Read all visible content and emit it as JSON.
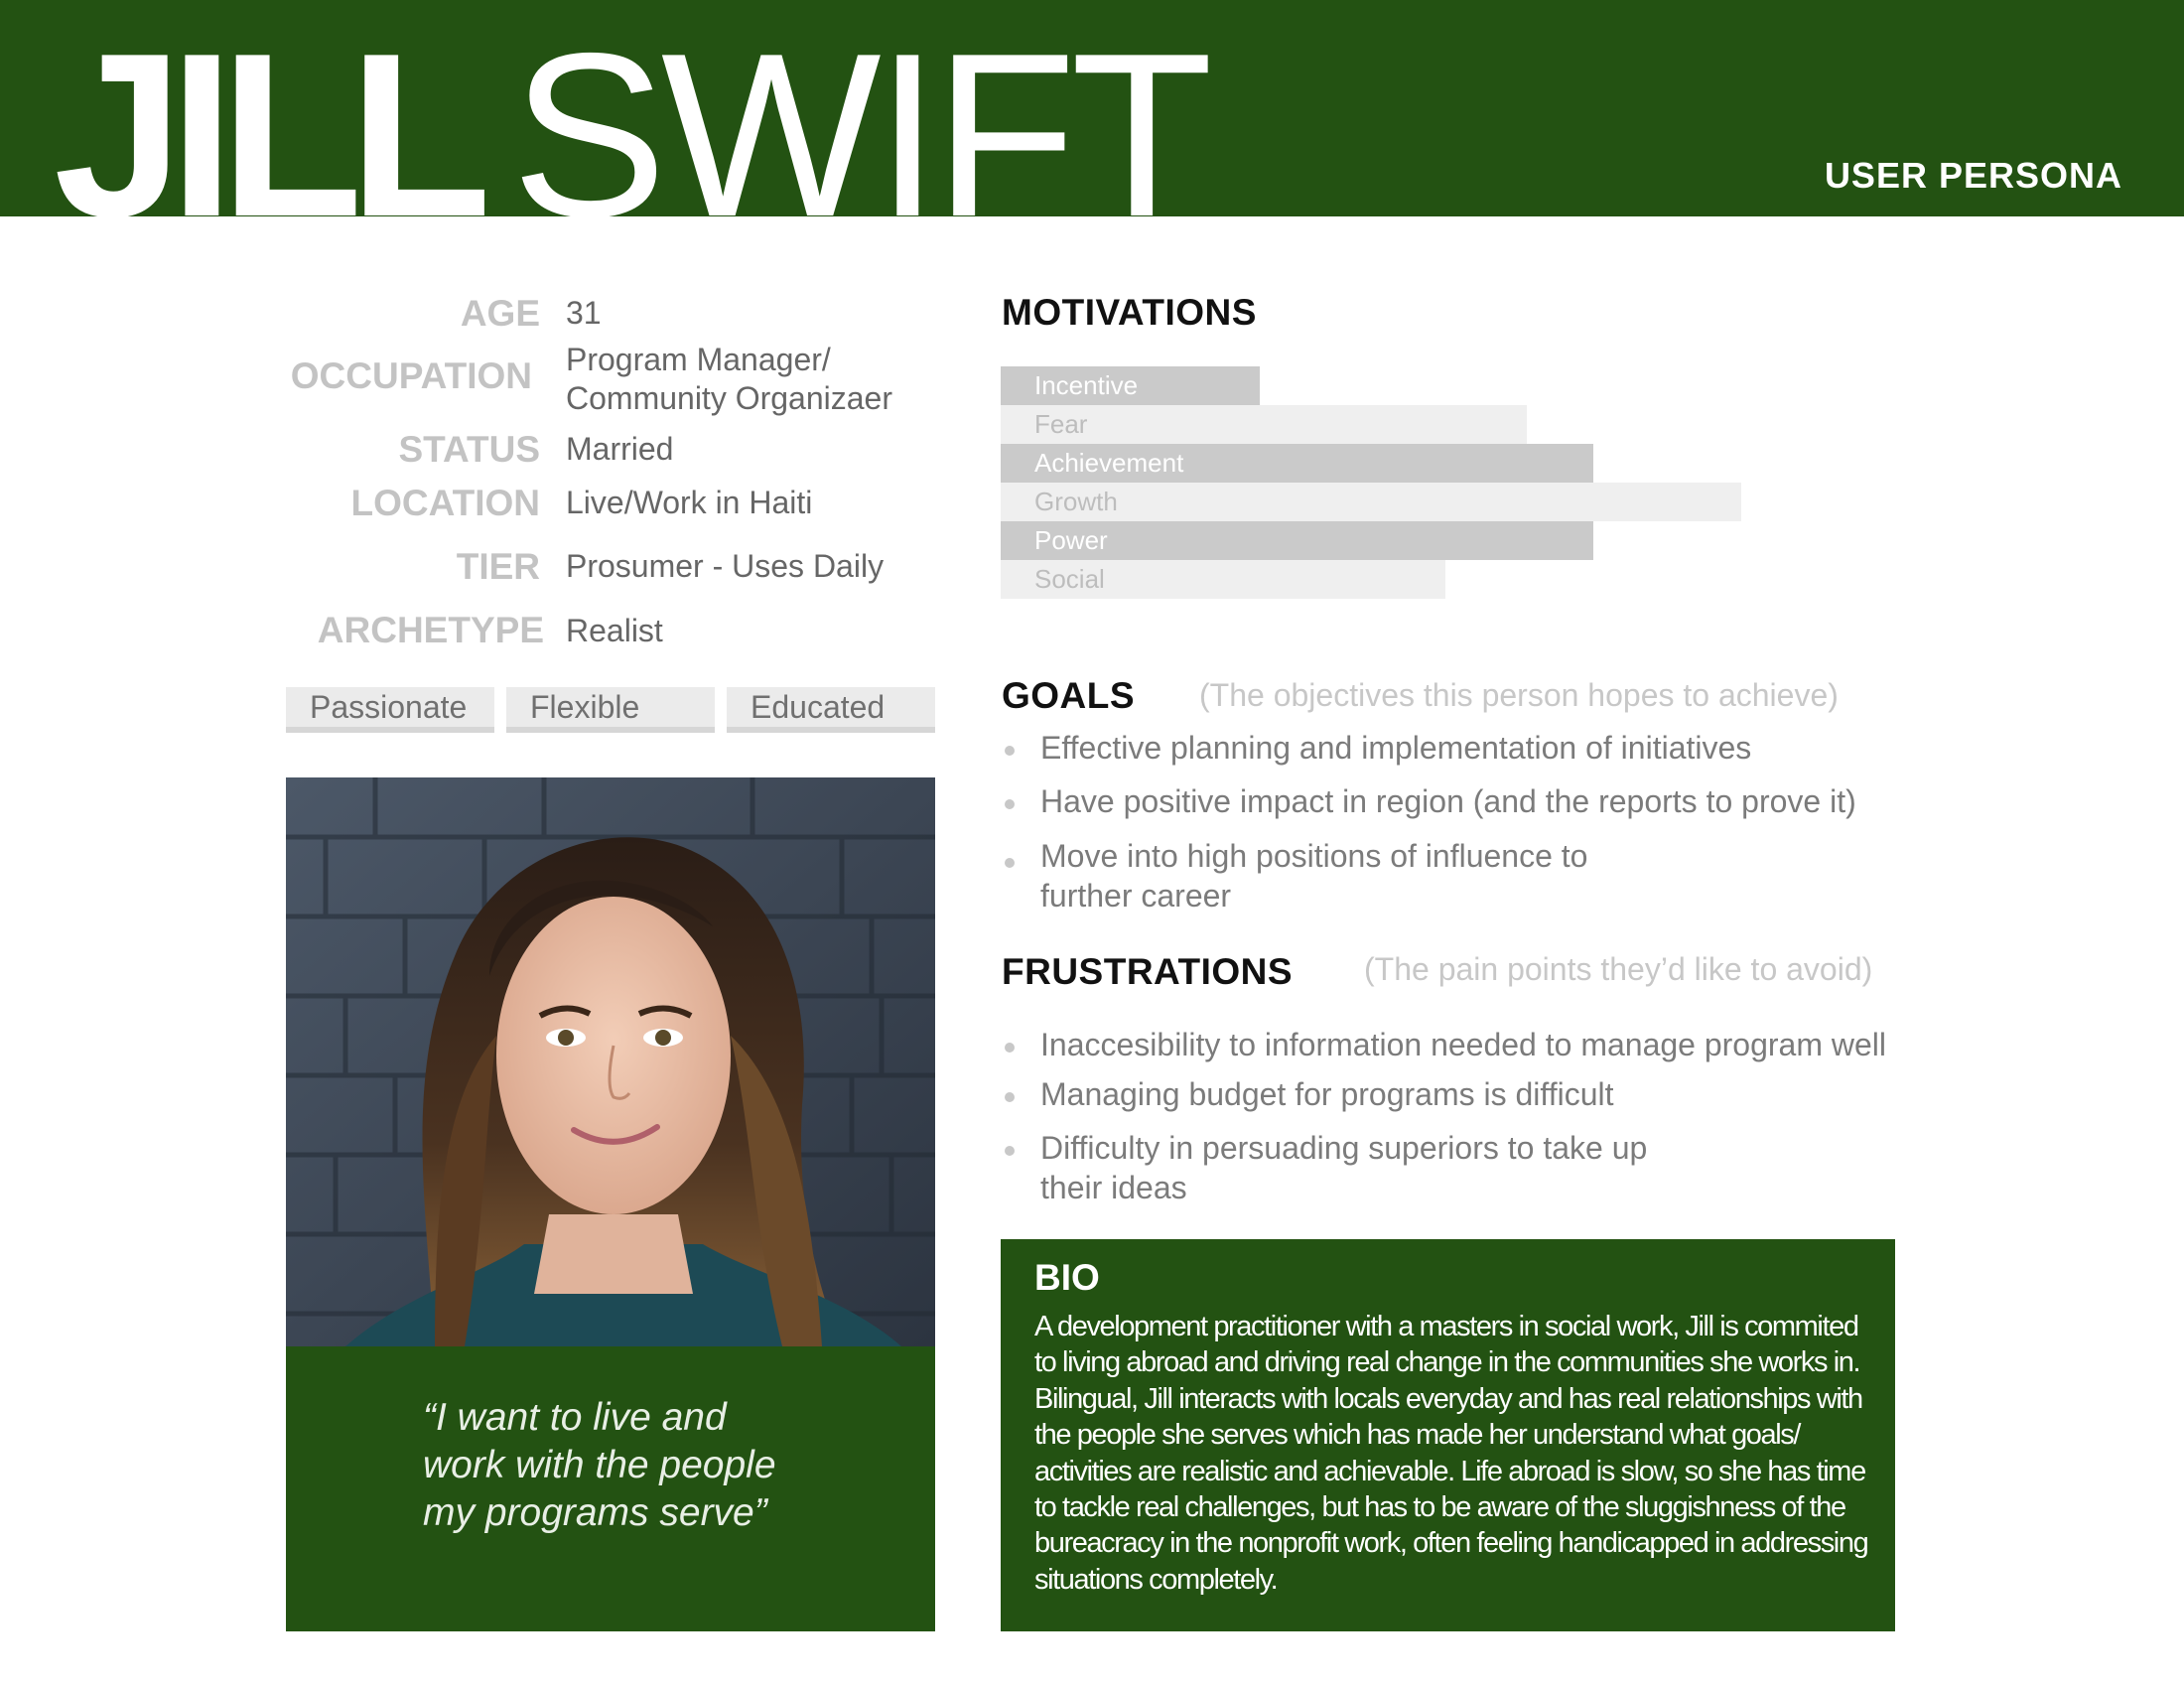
{
  "header": {
    "first_name": "JILL",
    "last_name": "SWIFT",
    "persona_label": "USER PERSONA",
    "background_color": "#235212"
  },
  "profile": {
    "fields": [
      {
        "label": "AGE",
        "value": "31"
      },
      {
        "label": "OCCUPATION",
        "value": "Program Manager/\nCommunity Organizaer"
      },
      {
        "label": "STATUS",
        "value": "Married"
      },
      {
        "label": "LOCATION",
        "value": "Live/Work in Haiti"
      },
      {
        "label": "TIER",
        "value": "Prosumer - Uses Daily"
      },
      {
        "label": "ARCHETYPE",
        "value": "Realist"
      }
    ],
    "traits": [
      "Passionate",
      "Flexible",
      "Educated"
    ],
    "photo": "portrait-photo",
    "quote": "“I want to live and\nwork with the people\nmy programs serve”"
  },
  "motivations": {
    "title": "MOTIVATIONS",
    "items": [
      {
        "label": "Incentive",
        "level": 0.35,
        "shade": "dark"
      },
      {
        "label": "Fear",
        "level": 0.71,
        "shade": "light"
      },
      {
        "label": "Achievement",
        "level": 0.8,
        "shade": "dark"
      },
      {
        "label": "Growth",
        "level": 1.0,
        "shade": "light"
      },
      {
        "label": "Power",
        "level": 0.8,
        "shade": "dark"
      },
      {
        "label": "Social",
        "level": 0.6,
        "shade": "light"
      }
    ]
  },
  "goals": {
    "title": "GOALS",
    "hint": "(The objectives this person hopes to achieve)",
    "items": [
      "Effective planning and implementation of initiatives",
      "Have positive impact in region (and the reports to prove it)",
      "Move into high positions of influence to\nfurther career"
    ]
  },
  "frustrations": {
    "title": "FRUSTRATIONS",
    "hint": "(The pain points they’d like to avoid)",
    "items": [
      "Inaccesibility to information needed to manage program well",
      "Managing budget for programs is difficult",
      "Difficulty in persuading superiors to take up\ntheir ideas"
    ]
  },
  "bio": {
    "title": "BIO",
    "text": "A development practitioner with a masters in social work, Jill is commited to living abroad and driving real change in the communities she works in. Bilingual, Jill interacts with locals everyday and has real relationships with the people she serves which has made her understand what goals/ activities are realistic and achievable. Life abroad is slow, so she has time to tackle real challenges, but has to be aware of the sluggishness of the bureacracy in the nonprofit work, often feeling handicapped in addressing situations completely."
  }
}
